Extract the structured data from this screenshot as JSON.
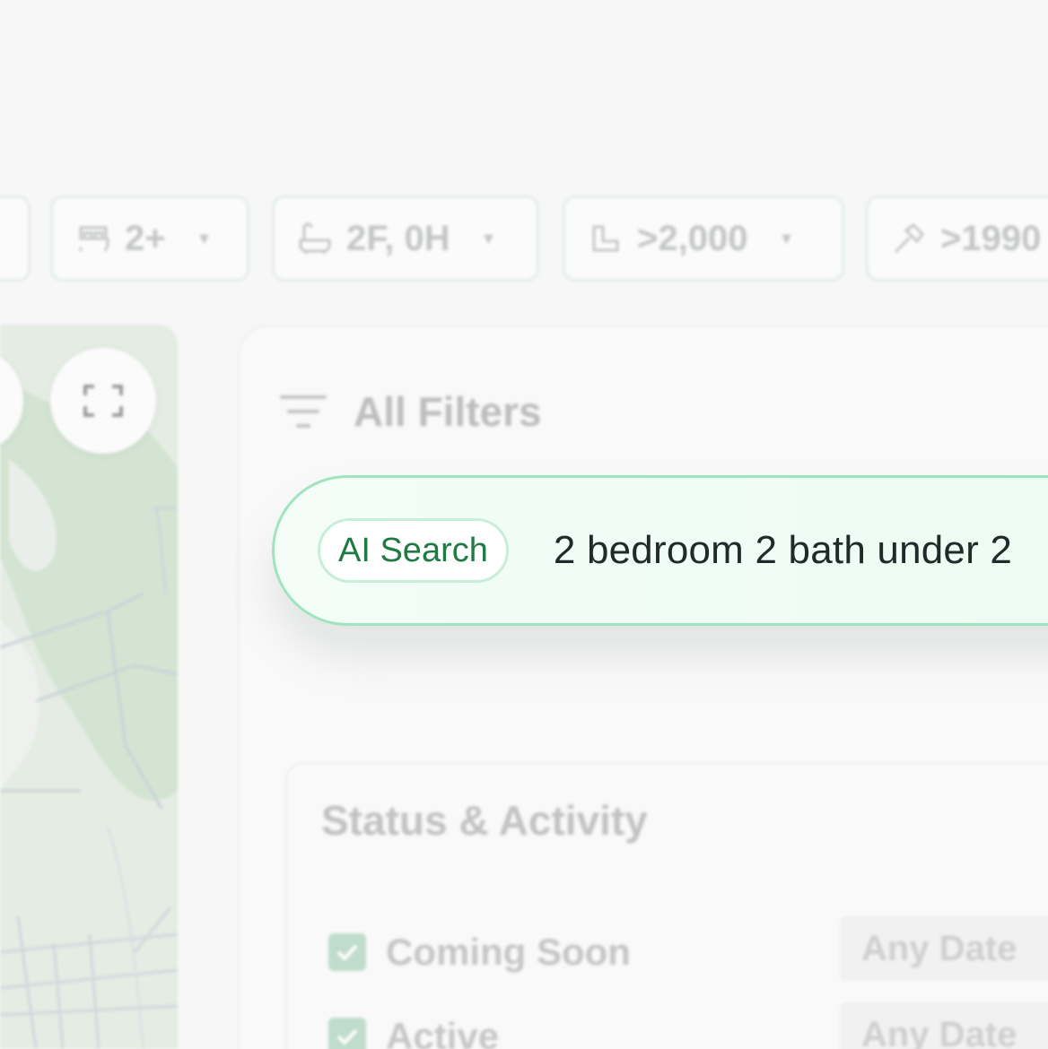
{
  "filter_bar": {
    "beds": "2+",
    "baths": "2F, 0H",
    "sqft": ">2,000",
    "year_built": ">1990"
  },
  "filters_panel": {
    "title": "All Filters"
  },
  "ai_search": {
    "badge": "AI Search",
    "query": "2 bedroom 2 bath under 2"
  },
  "status_section": {
    "title": "Status & Activity",
    "rows": [
      {
        "label": "Coming Soon",
        "date": "Any Date",
        "checked": true
      },
      {
        "label": "Active",
        "date": "Any Date",
        "checked": true
      }
    ]
  },
  "colors": {
    "accent_green": "#1f7a43",
    "search_border": "#9ee4bf",
    "checkbox_fill": "#bfdccc"
  },
  "icons": [
    "bed-icon",
    "bath-icon",
    "ruler-icon",
    "hammer-icon",
    "fullscreen-icon",
    "filter-lines-icon",
    "check-icon"
  ]
}
